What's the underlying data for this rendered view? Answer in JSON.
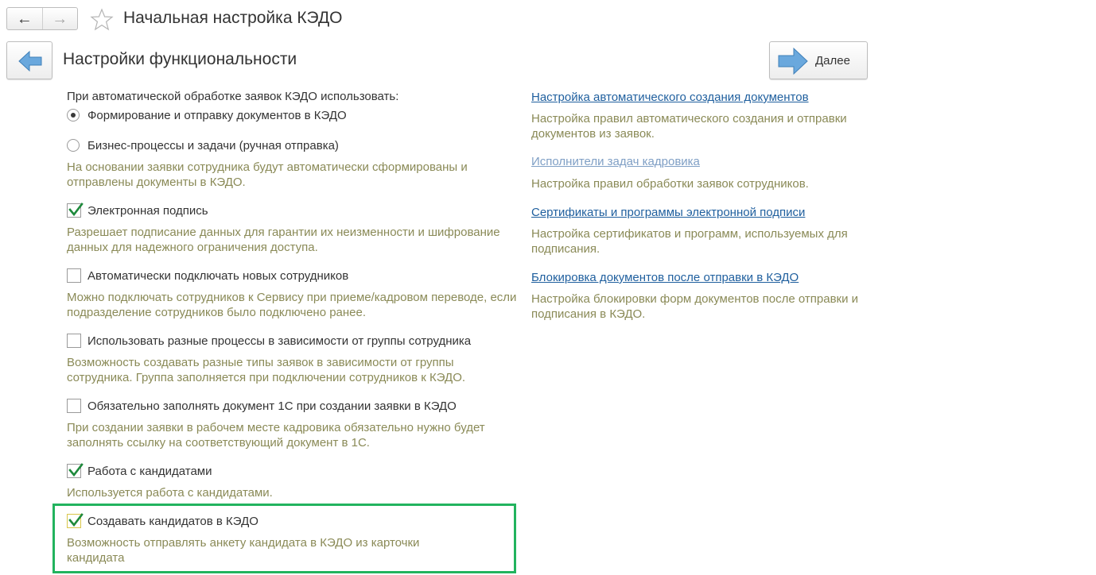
{
  "window": {
    "title": "Начальная настройка КЭДО"
  },
  "page": {
    "title": "Настройки функциональности",
    "next_label": "Далее"
  },
  "question": "При автоматической обработке заявок КЭДО использовать:",
  "radio_options": [
    {
      "label": "Формирование и отправку документов в КЭДО",
      "selected": true
    },
    {
      "label": "Бизнес-процессы и задачи (ручная отправка)",
      "selected": false
    }
  ],
  "radio_description": "На основании заявки сотрудника будут автоматически сформированы и отправлены документы в КЭДО.",
  "options": [
    {
      "label": "Электронная подпись",
      "checked": true,
      "description": "Разрешает подписание данных для гарантии их неизменности и шифрование данных для надежного ограничения доступа."
    },
    {
      "label": "Автоматически подключать новых сотрудников",
      "checked": false,
      "description": "Можно подключать сотрудников к Сервису при приеме/кадровом переводе, если подразделение сотрудников было подключено ранее."
    },
    {
      "label": "Использовать разные процессы в зависимости от группы сотрудника",
      "checked": false,
      "description": "Возможность создавать разные типы заявок в зависимости от группы сотрудника. Группа заполняется при подключении сотрудников к КЭДО."
    },
    {
      "label": "Обязательно заполнять документ 1С при создании заявки в КЭДО",
      "checked": false,
      "description": "При создании заявки в рабочем месте кадровика обязательно нужно будет заполнять ссылку на соответствующий документ в 1С."
    },
    {
      "label": "Работа с кандидатами",
      "checked": true,
      "description": "Используется работа с кандидатами."
    },
    {
      "label": "Создавать кандидатов в КЭДО",
      "checked": true,
      "description": "Возможность отправлять анкету кандидата в КЭДО из карточки кандидата"
    }
  ],
  "links": [
    {
      "label": "Настройка автоматического создания документов",
      "description": "Настройка правил автоматического создания и отправки документов из заявок."
    },
    {
      "label": "Исполнители задач кадровика",
      "description": "Настройка правил обработки заявок сотрудников."
    },
    {
      "label": "Сертификаты и программы электронной подписи",
      "description": "Настройка сертификатов и программ, используемых для подписания."
    },
    {
      "label": "Блокировка документов после отправки в КЭДО",
      "description": "Настройка блокировки форм документов после отправки и подписания в КЭДО."
    }
  ],
  "icons": {
    "back": "arrow-left-icon",
    "forward": "arrow-right-icon",
    "favorite": "star-icon",
    "step_back": "blue-arrow-left-icon",
    "step_next": "blue-arrow-right-icon",
    "check": "checkmark-icon"
  },
  "colors": {
    "link": "#1f5f9e",
    "link_visited": "#7f9fc5",
    "description": "#8a8a57",
    "check_mark": "#1e8a3c",
    "highlight": "#22b35e",
    "arrow_blue": "#5b9bd5"
  }
}
